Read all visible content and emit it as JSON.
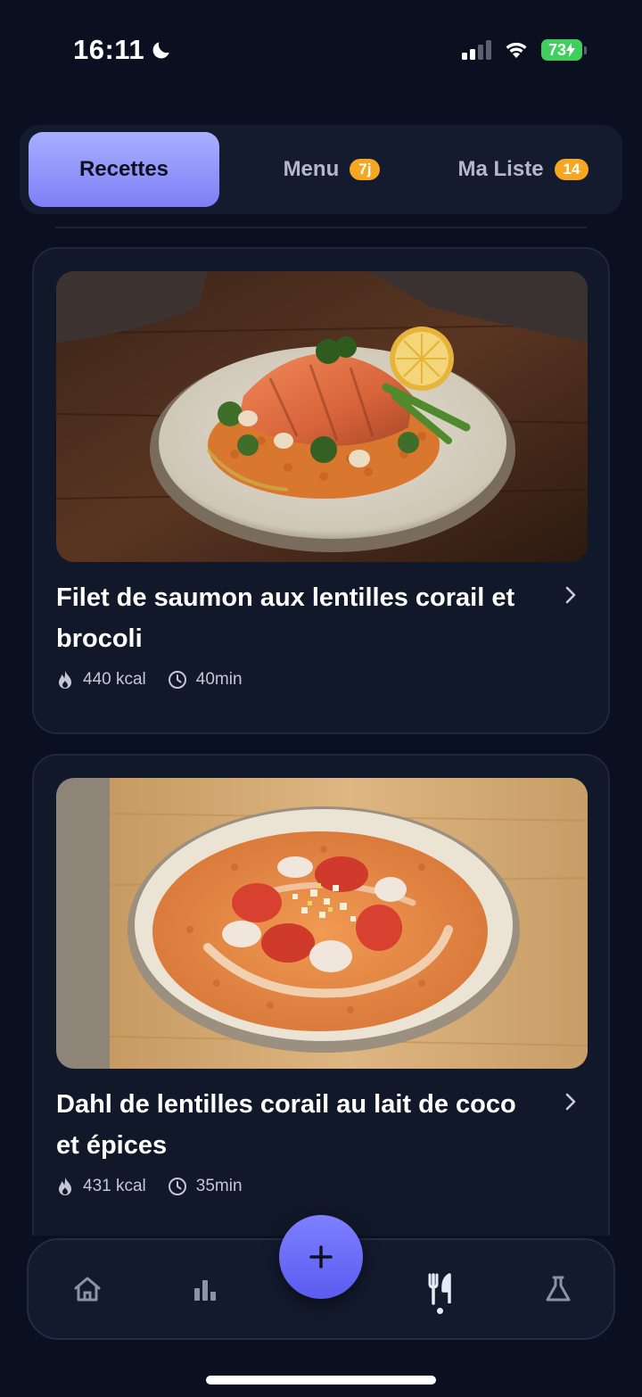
{
  "status_bar": {
    "time": "16:11",
    "battery": "73"
  },
  "tabs": [
    {
      "label": "Recettes",
      "badge": ""
    },
    {
      "label": "Menu",
      "badge": "7j"
    },
    {
      "label": "Ma Liste",
      "badge": "14"
    }
  ],
  "recipes": [
    {
      "title": "Filet de saumon aux lentilles corail et brocoli",
      "kcal": "440 kcal",
      "time": "40min"
    },
    {
      "title": "Dahl de lentilles corail au lait de coco et épices",
      "kcal": "431 kcal",
      "time": "35min"
    }
  ],
  "nav": {
    "items": [
      "home-icon",
      "stats-icon",
      "add-icon",
      "recipes-icon",
      "lab-icon"
    ],
    "active": "recipes-icon"
  },
  "colors": {
    "background": "#0b1020",
    "accent": "#7e7ff7",
    "badge": "#f5a623",
    "battery": "#3fcf5c"
  }
}
